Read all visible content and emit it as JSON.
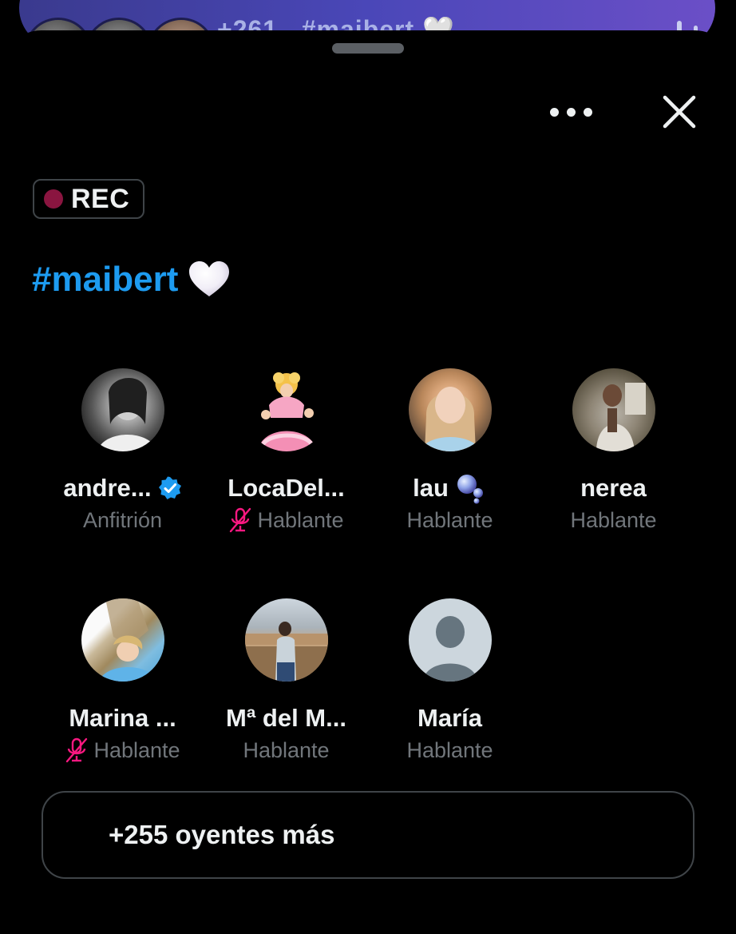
{
  "mini_bar": {
    "listener_count": "+261",
    "title": "#maibert 🤍"
  },
  "header": {
    "more_icon": "more-horizontal-icon",
    "close_icon": "close-icon"
  },
  "recording": {
    "label": "REC",
    "dot_color": "#8a1540"
  },
  "space": {
    "hashtag": "#maibert",
    "emoji": "white-heart-icon",
    "accent_color": "#1d9bf0"
  },
  "participants": [
    {
      "name": "andre...",
      "role": "Anfitrión",
      "verified": true,
      "muted": false,
      "badge": null
    },
    {
      "name": "LocaDel...",
      "role": "Hablante",
      "verified": false,
      "muted": true,
      "badge": null
    },
    {
      "name": "lau",
      "role": "Hablante",
      "verified": false,
      "muted": false,
      "badge": "bubbles-icon"
    },
    {
      "name": "nerea",
      "role": "Hablante",
      "verified": false,
      "muted": false,
      "badge": null
    },
    {
      "name": "Marina ...",
      "role": "Hablante",
      "verified": false,
      "muted": true,
      "badge": null
    },
    {
      "name": "Mª del M...",
      "role": "Hablante",
      "verified": false,
      "muted": false,
      "badge": null
    },
    {
      "name": "María",
      "role": "Hablante",
      "verified": false,
      "muted": false,
      "badge": null
    }
  ],
  "listeners": {
    "label": "+255 oyentes más"
  },
  "colors": {
    "muted_mic": "#f91880",
    "verified": "#1d9bf0",
    "secondary_text": "#71767b"
  }
}
